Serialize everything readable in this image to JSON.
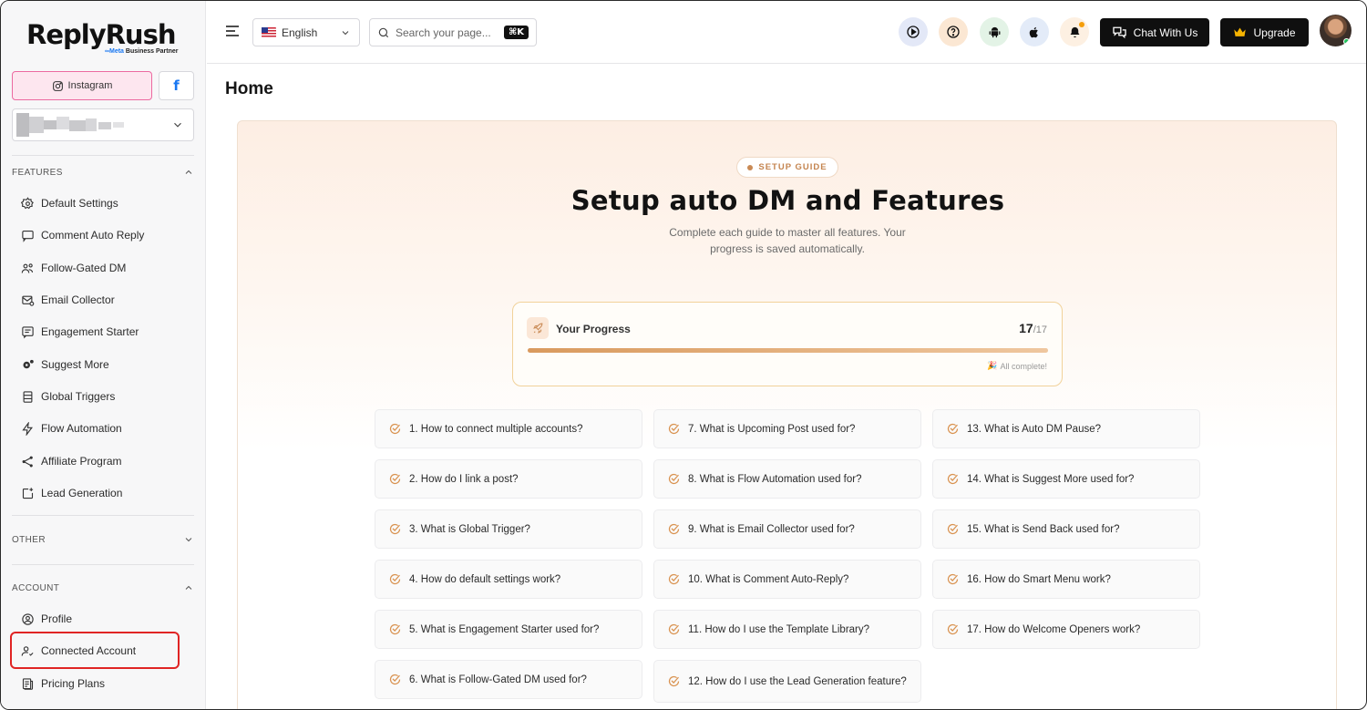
{
  "brand": {
    "name": "ReplyRush",
    "partner_meta": "∞Meta",
    "partner_text": " Business Partner"
  },
  "sidebar": {
    "platforms": {
      "instagram": "Instagram",
      "facebook": "f"
    },
    "sections": {
      "features": "FEATURES",
      "other": "OTHER",
      "account": "ACCOUNT"
    },
    "features": [
      {
        "label": "Default Settings",
        "icon": "gear-icon"
      },
      {
        "label": "Comment Auto Reply",
        "icon": "comment-icon"
      },
      {
        "label": "Follow-Gated DM",
        "icon": "users-icon"
      },
      {
        "label": "Email Collector",
        "icon": "email-icon"
      },
      {
        "label": "Engagement Starter",
        "icon": "chat-bubble-icon"
      },
      {
        "label": "Suggest More",
        "icon": "cog-icon"
      },
      {
        "label": "Global Triggers",
        "icon": "list-icon"
      },
      {
        "label": "Flow Automation",
        "icon": "lightning-icon"
      },
      {
        "label": "Affiliate Program",
        "icon": "share-icon"
      },
      {
        "label": "Lead Generation",
        "icon": "add-box-icon"
      }
    ],
    "account": [
      {
        "label": "Profile",
        "icon": "user-circle-icon"
      },
      {
        "label": "Connected Account",
        "icon": "user-check-icon"
      },
      {
        "label": "Pricing Plans",
        "icon": "receipt-icon"
      }
    ]
  },
  "header": {
    "language": "English",
    "search_placeholder": "Search your page...",
    "search_shortcut": "⌘K",
    "chat_label": "Chat With Us",
    "upgrade_label": "Upgrade"
  },
  "main": {
    "title": "Home",
    "badge": "SETUP GUIDE",
    "hero_title": "Setup auto DM and Features",
    "hero_subtitle": "Complete each guide to master all features. Your progress is saved automatically.",
    "progress": {
      "label": "Your Progress",
      "done": "17",
      "total": "/17",
      "fraction": 1.0,
      "status": "All complete!"
    },
    "guides": [
      "1. How to connect multiple accounts?",
      "2. How do I link a post?",
      "3. What is Global Trigger?",
      "4. How do default settings work?",
      "5. What is Engagement Starter used for?",
      "6. What is Follow-Gated DM used for?",
      "7. What is Upcoming Post used for?",
      "8. What is Flow Automation used for?",
      "9. What is Email Collector used for?",
      "10. What is Comment Auto-Reply?",
      "11. How do I use the Template Library?",
      "12. How do I use the Lead Generation feature?",
      "13. What is Auto DM Pause?",
      "14. What is Suggest More used for?",
      "15. What is Send Back used for?",
      "16. How do Smart Menu work?",
      "17. How do Welcome Openers work?"
    ]
  },
  "colors": {
    "accent": "#d9924f",
    "highlight": "#e02424",
    "instagram_bg": "#fde6ef"
  }
}
